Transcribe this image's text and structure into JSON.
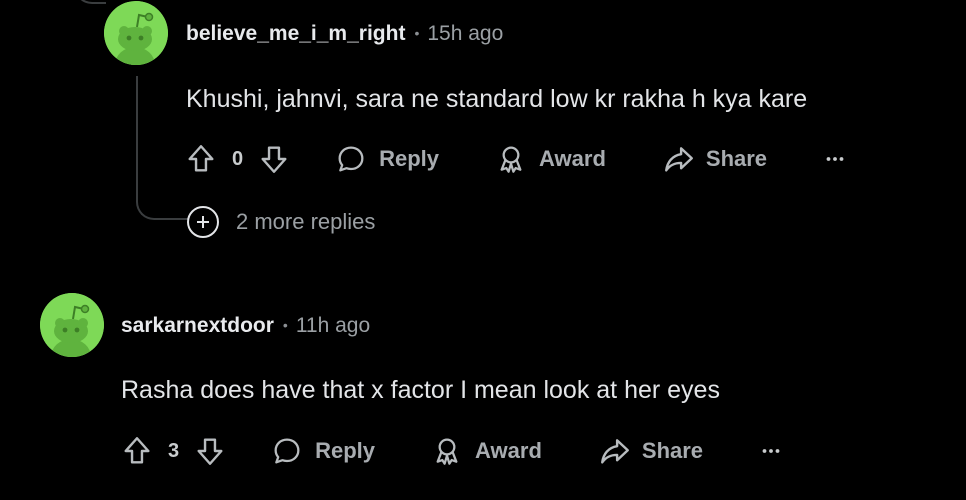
{
  "comments": [
    {
      "username": "believe_me_i_m_right",
      "separator": "•",
      "time": "15h ago",
      "text": "Khushi, jahnvi, sara ne standard low kr rakha h kya kare",
      "votes": "0",
      "reply_label": "Reply",
      "award_label": "Award",
      "share_label": "Share",
      "more_icon": "…",
      "more_replies": "2 more replies"
    },
    {
      "username": "sarkarnextdoor",
      "separator": "•",
      "time": "11h ago",
      "text": "Rasha does have that x factor I mean look at her eyes",
      "votes": "3",
      "reply_label": "Reply",
      "award_label": "Award",
      "share_label": "Share",
      "more_icon": "…"
    }
  ],
  "icons": {
    "upvote": "upvote-icon",
    "downvote": "downvote-icon",
    "reply": "speech-bubble-icon",
    "award": "award-ribbon-icon",
    "share": "share-arrow-icon",
    "overflow": "ellipsis-icon",
    "expand": "plus-circle-icon"
  },
  "colors": {
    "background": "#000000",
    "avatar": "#7ed957",
    "text": "#e3e5e8",
    "muted": "#9ba0a4",
    "thread_line": "#3a3d3f"
  }
}
